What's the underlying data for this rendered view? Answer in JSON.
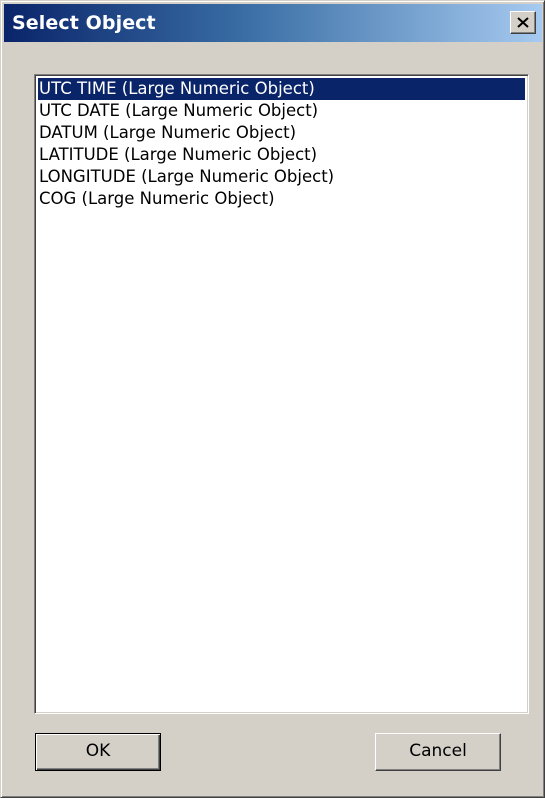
{
  "dialog": {
    "title": "Select Object",
    "close_icon": "close-icon"
  },
  "list": {
    "items": [
      {
        "label": "UTC TIME (Large Numeric Object)",
        "selected": true
      },
      {
        "label": "UTC DATE (Large Numeric Object)",
        "selected": false
      },
      {
        "label": "DATUM (Large Numeric Object)",
        "selected": false
      },
      {
        "label": "LATITUDE (Large Numeric Object)",
        "selected": false
      },
      {
        "label": "LONGITUDE (Large Numeric Object)",
        "selected": false
      },
      {
        "label": "COG (Large Numeric Object)",
        "selected": false
      }
    ]
  },
  "buttons": {
    "ok_label": "OK",
    "cancel_label": "Cancel"
  },
  "colors": {
    "titlebar_start": "#0a246a",
    "titlebar_end": "#a6caf0",
    "selection": "#0a246a",
    "face": "#d4d0c8"
  }
}
